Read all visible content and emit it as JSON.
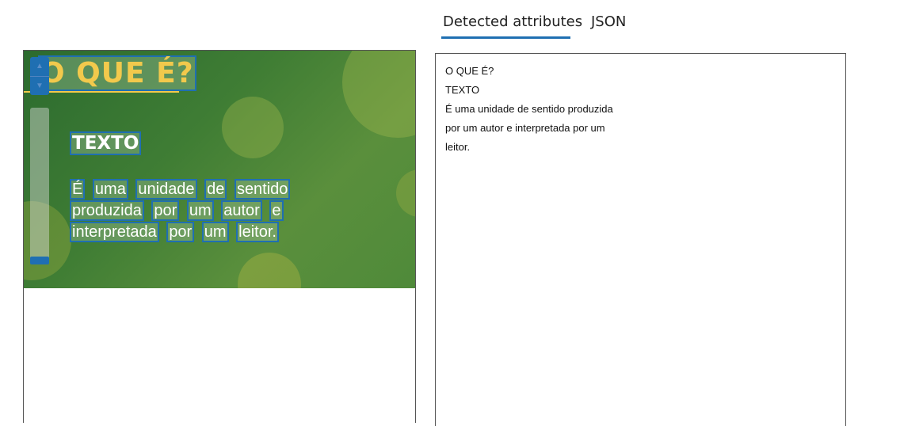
{
  "tabs": [
    {
      "label": "Detected attributes",
      "active": true
    },
    {
      "label": "JSON",
      "active": false
    }
  ],
  "accent_color": "#1f6fb2",
  "image": {
    "title": "O QUE É?",
    "heading": "TEXTO",
    "body_words": [
      "É",
      "uma",
      "unidade",
      "de",
      "sentido",
      "produzida",
      "por",
      "um",
      "autor",
      "e",
      "interpretada",
      "por",
      "um",
      "leitor."
    ]
  },
  "detected_lines": [
    "O QUE É?",
    "TEXTO",
    "É uma unidade de sentido produzida",
    "por um autor e interpretada por um",
    "leitor."
  ]
}
